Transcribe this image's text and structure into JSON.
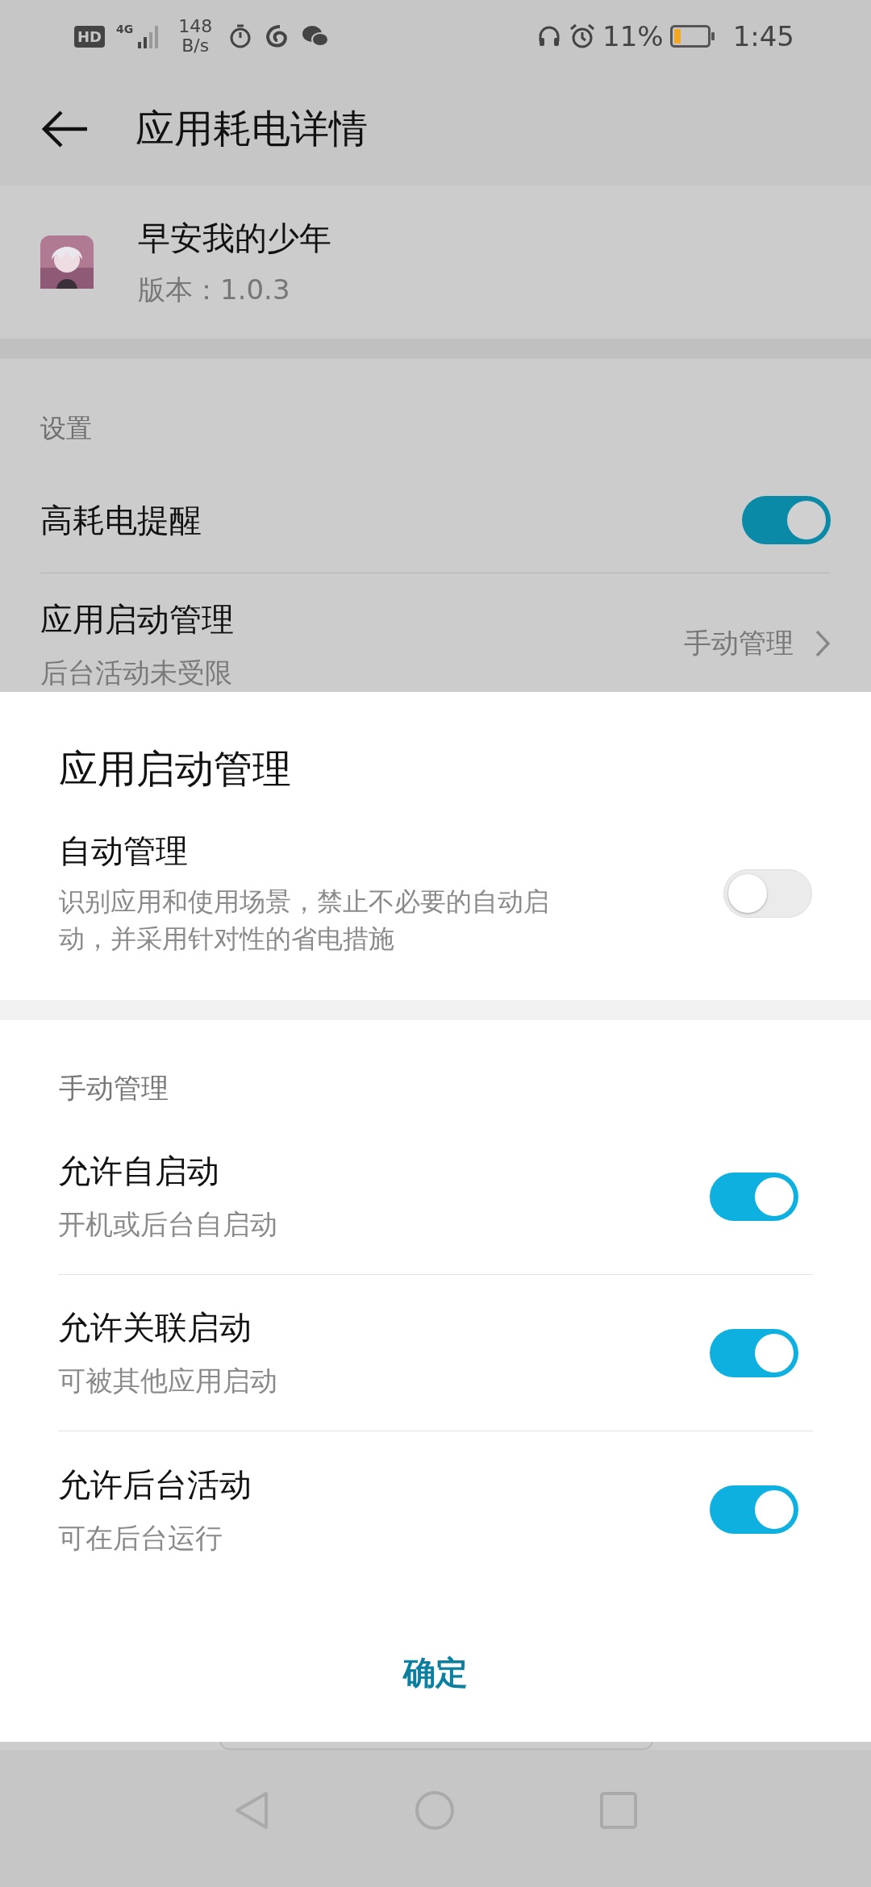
{
  "status_bar": {
    "hd_badge": "HD",
    "network": "4G",
    "speed_value": "148",
    "speed_unit": "B/s",
    "battery_percent": "11%",
    "time": "1:45"
  },
  "header": {
    "title": "应用耗电详情"
  },
  "app": {
    "name": "早安我的少年",
    "version": "版本：1.0.3"
  },
  "settings": {
    "section_label": "设置",
    "items": [
      {
        "kind": "toggle",
        "label": "高耗电提醒",
        "on": true
      },
      {
        "kind": "link",
        "label": "应用启动管理",
        "subtitle": "后台活动未受限",
        "value": "手动管理"
      }
    ]
  },
  "dialog": {
    "title": "应用启动管理",
    "auto": {
      "label": "自动管理",
      "description": "识别应用和使用场景，禁止不必要的自动启动，并采用针对性的省电措施",
      "on": false
    },
    "manual": {
      "section_label": "手动管理",
      "items": [
        {
          "label": "允许自启动",
          "subtitle": "开机或后台自启动",
          "on": true
        },
        {
          "label": "允许关联启动",
          "subtitle": "可被其他应用启动",
          "on": true
        },
        {
          "label": "允许后台活动",
          "subtitle": "可在后台运行",
          "on": true
        }
      ]
    },
    "confirm": "确定"
  }
}
